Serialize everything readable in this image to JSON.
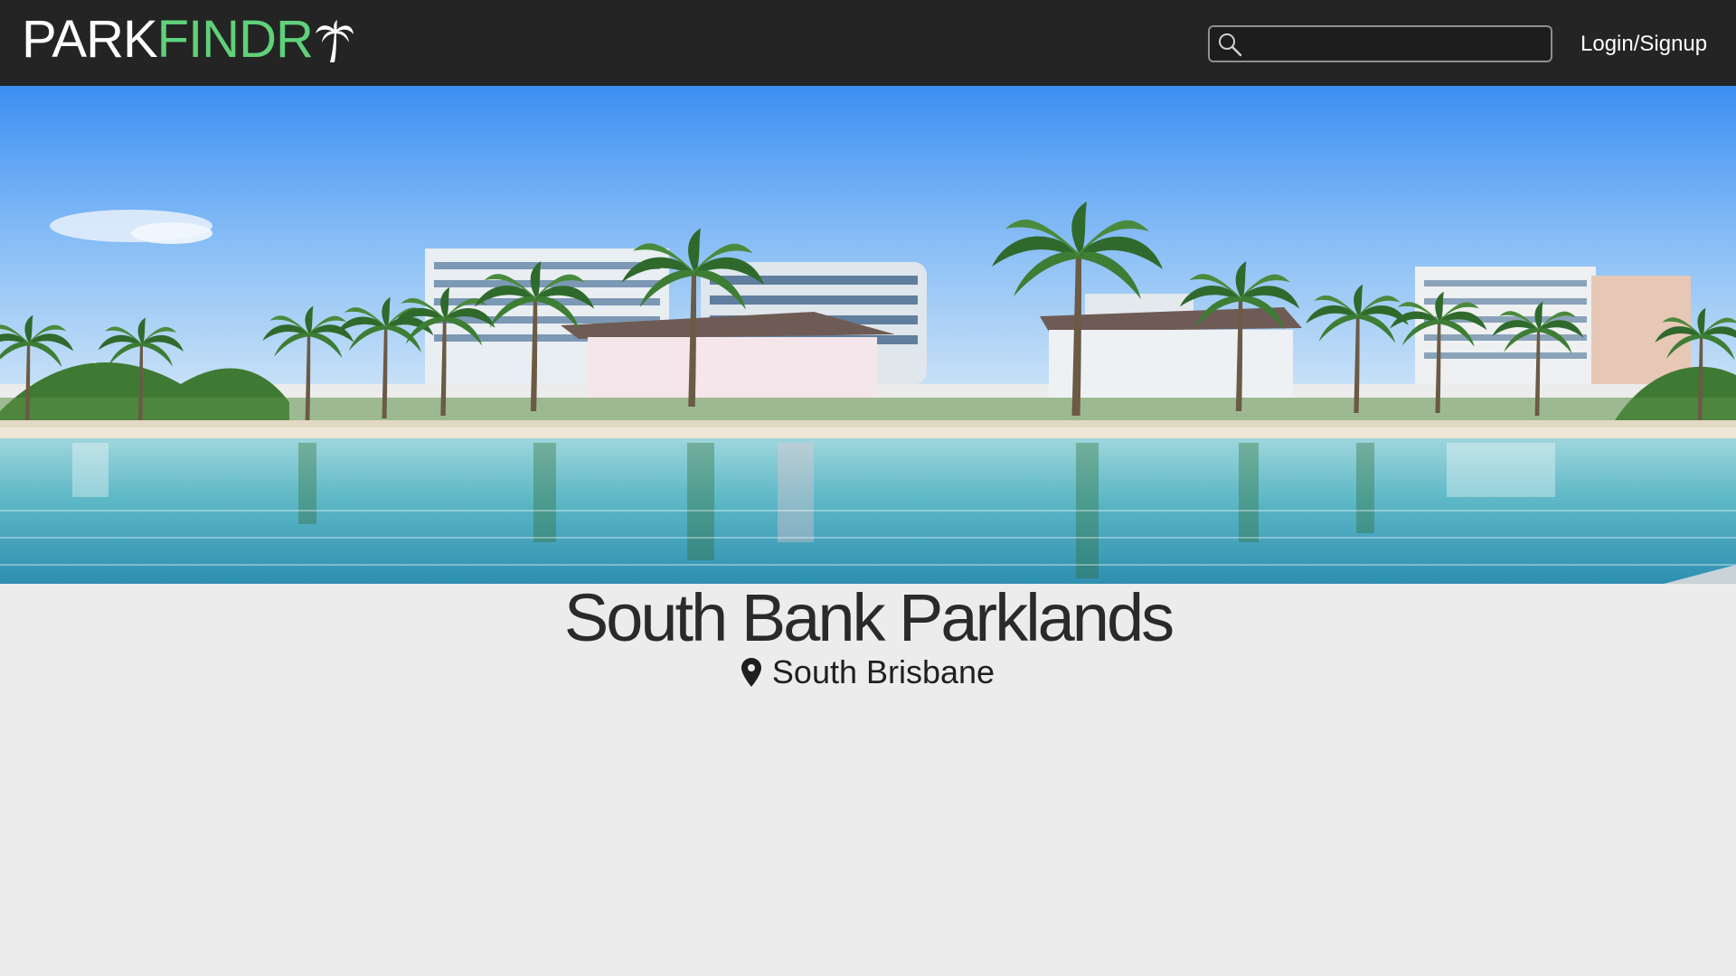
{
  "header": {
    "logo": {
      "part1": "PARK",
      "part2": "FINDR",
      "icon": "palm-tree-icon"
    },
    "search": {
      "placeholder": "",
      "value": "",
      "icon": "search-icon"
    },
    "login_label": "Login/Signup"
  },
  "hero": {
    "image": "South Bank beach lagoon panorama with palm trees and buildings"
  },
  "park": {
    "name": "South Bank Parklands",
    "location": "South Brisbane",
    "location_icon": "map-pin-icon"
  },
  "colors": {
    "header_bg": "#242424",
    "logo_accent": "#5fd17a",
    "page_bg": "#ececec",
    "text_dark": "#2a2a2a"
  }
}
